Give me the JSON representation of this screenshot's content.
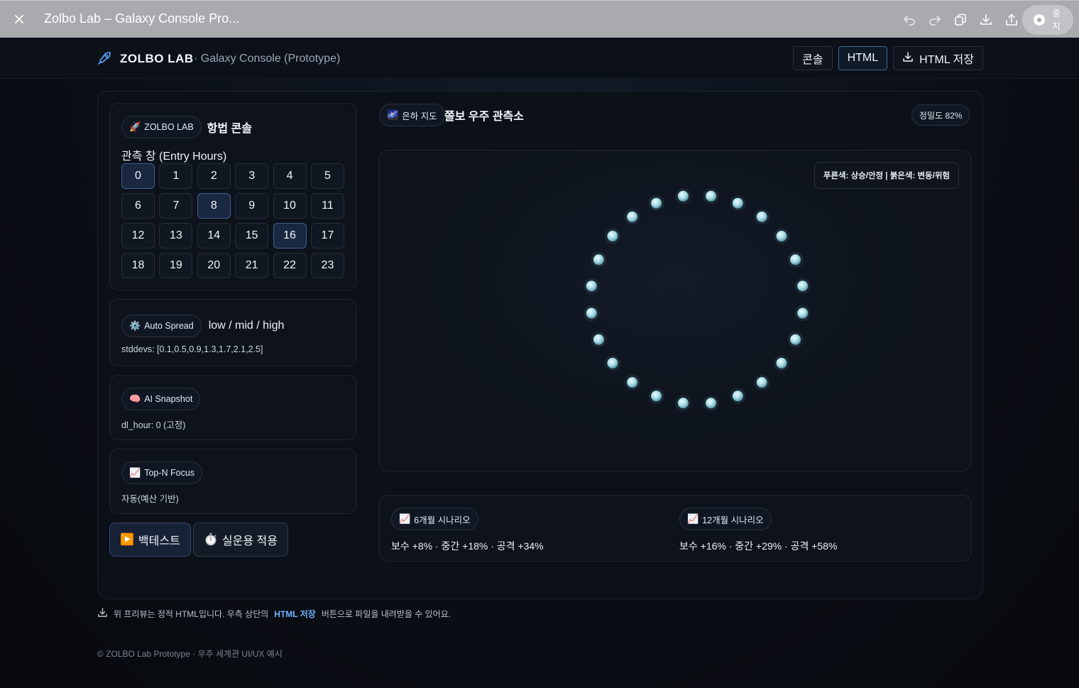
{
  "window": {
    "title": "Zolbo Lab – Galaxy Console Pro...",
    "stop_label": "중지",
    "tools": [
      "undo-icon",
      "redo-icon",
      "copy-icon",
      "download-icon",
      "share-icon"
    ]
  },
  "header": {
    "brand": "ZOLBO LAB",
    "subtitle": "· Galaxy Console (Prototype)",
    "buttons": {
      "console": "콘솔",
      "html": "HTML",
      "save_html": "HTML 저장"
    }
  },
  "sidebar": {
    "console_panel": {
      "badge": "ZOLBO LAB",
      "title": "항법 콘솔",
      "hours_label": "관측 창 (Entry Hours)",
      "hours": [
        "0",
        "1",
        "2",
        "3",
        "4",
        "5",
        "6",
        "7",
        "8",
        "9",
        "10",
        "11",
        "12",
        "13",
        "14",
        "15",
        "16",
        "17",
        "18",
        "19",
        "20",
        "21",
        "22",
        "23"
      ],
      "selected_hours": [
        0,
        8,
        16
      ]
    },
    "auto_spread": {
      "badge": "Auto Spread",
      "value": "low / mid / high",
      "note": "stddevs: [0.1,0.5,0.9,1.3,1.7,2.1,2.5]"
    },
    "ai_snapshot": {
      "badge": "AI Snapshot",
      "note": "dl_hour: 0 (고정)"
    },
    "top_n": {
      "badge": "Top-N Focus",
      "note": "자동(예산 기반)"
    },
    "actions": {
      "backtest": "백테스트",
      "apply": "실운용 적용"
    }
  },
  "observatory": {
    "badge": "은하 지도",
    "title": "쫄보 우주 관측소",
    "precision": "정밀도 82%",
    "legend": "푸른색: 상승/안정 | 붉은색: 변동/위험"
  },
  "chart_data": {
    "type": "scatter",
    "description_layout": "ring",
    "point_count": 24,
    "series": [
      {
        "color": "#a9dde6",
        "count": 24
      }
    ]
  },
  "scenarios": [
    {
      "badge": "6개월 시나리오",
      "text": "보수 +8% · 중간 +18% · 공격 +34%"
    },
    {
      "badge": "12개월 시나리오",
      "text": "보수 +16% · 중간 +29% · 공격 +58%"
    }
  ],
  "footer": {
    "note_before": "위 프리뷰는 정적 HTML입니다. 우측 상단의",
    "note_link": "HTML 저장",
    "note_after": "버튼으로 파일을 내려받을 수 있어요.",
    "copyright": "© ZOLBO Lab Prototype · 우주 세계관 UI/UX 예시"
  }
}
